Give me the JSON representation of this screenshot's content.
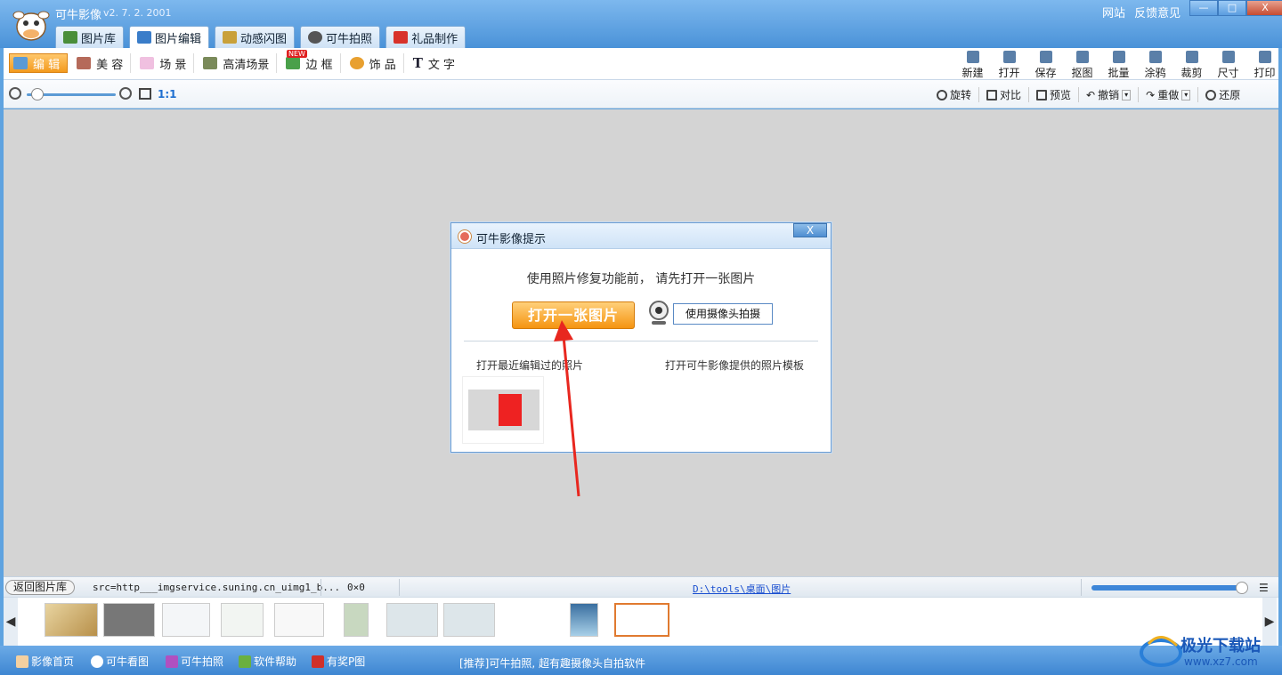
{
  "app": {
    "title": "可牛影像",
    "version": "v2. 7. 2. 2001"
  },
  "top_links": [
    "网站",
    "反馈意见"
  ],
  "window_buttons": {
    "minimize": "—",
    "maximize": "□",
    "close": "X"
  },
  "main_tabs": [
    {
      "label": "图片库",
      "active": false
    },
    {
      "label": "图片编辑",
      "active": true
    },
    {
      "label": "动感闪图",
      "active": false
    },
    {
      "label": "可牛拍照",
      "active": false
    },
    {
      "label": "礼品制作",
      "active": false
    }
  ],
  "sub_tabs": [
    {
      "label": "编 辑",
      "active": true
    },
    {
      "label": "美 容"
    },
    {
      "label": "场 景"
    },
    {
      "label": "高清场景"
    },
    {
      "label": "边 框"
    },
    {
      "label": "饰 品"
    },
    {
      "label": "文 字"
    }
  ],
  "new_badge": "NEW",
  "tools": [
    "新建",
    "打开",
    "保存",
    "抠图",
    "批量",
    "涂鸦",
    "裁剪",
    "尺寸",
    "打印"
  ],
  "zoom": {
    "ratio": "1:1",
    "level": 0.05
  },
  "actions": [
    "旋转",
    "对比",
    "预览",
    "撤销",
    "重做",
    "还原"
  ],
  "dialog": {
    "title": "可牛影像提示",
    "close": "X",
    "message": "使用照片修复功能前， 请先打开一张图片",
    "open_button": "打开一张图片",
    "camera_button": "使用摄像头拍摄",
    "recent_label": "打开最近编辑过的照片",
    "template_label": "打开可牛影像提供的照片模板"
  },
  "status": {
    "back_button": "返回图片库",
    "src": "src=http___imgservice.suning.cn_uimg1_b...",
    "size": "0×0",
    "path": "D:\\tools\\桌面\\图片",
    "thumb_size_level": 0.98
  },
  "filmstrip": {
    "left_arrow": "◀",
    "right_arrow": "▶"
  },
  "bottom_bar": [
    {
      "label": "影像首页"
    },
    {
      "label": "可牛看图"
    },
    {
      "label": "可牛拍照"
    },
    {
      "label": "软件帮助"
    },
    {
      "label": "有奖P图"
    }
  ],
  "promo": "[推荐]可牛拍照, 超有趣摄像头自拍软件",
  "watermark": {
    "text": "极光下载站",
    "url": "www.xz7.com"
  },
  "colors": {
    "accent": "#f59411",
    "titlebar": "#4a92d8",
    "canvas": "#d4d4d4",
    "annotation_arrow": "#e8271f"
  }
}
